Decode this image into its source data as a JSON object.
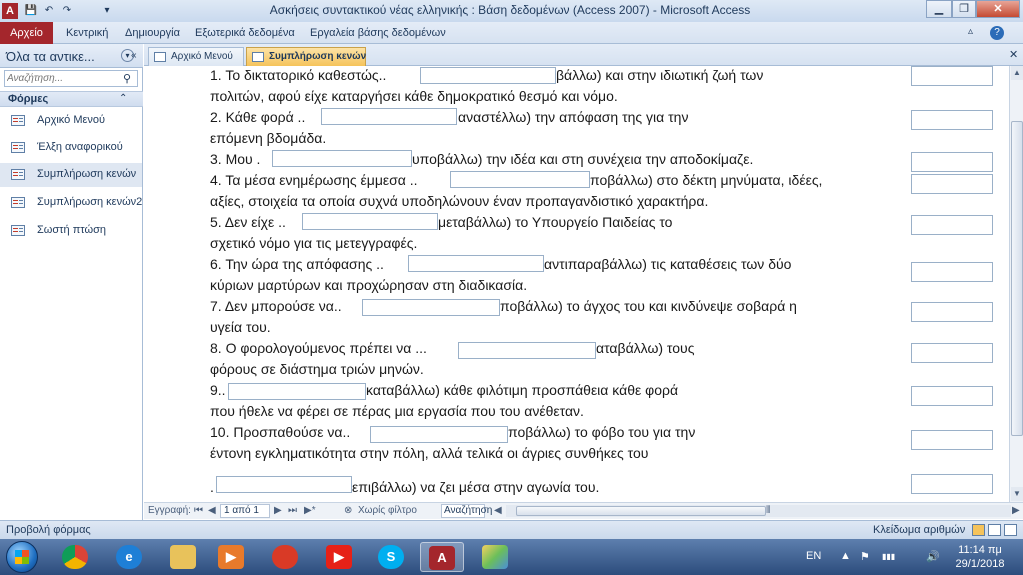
{
  "window": {
    "title": "Ασκήσεις συντακτικού νέας ελληνικής : Βάση δεδομένων (Access 2007)  -  Microsoft Access",
    "controls": {
      "minimize": "▁",
      "restore": "❐",
      "close": "✕"
    }
  },
  "quick_access": {
    "app_icon": "A",
    "save_icon": "💾",
    "undo_icon": "↶",
    "redo_icon": "↷",
    "customize_icon": "▾"
  },
  "ribbon": {
    "file_tab": "Αρχείο",
    "tabs": [
      "Κεντρική",
      "Δημιουργία",
      "Εξωτερικά δεδομένα",
      "Εργαλεία βάσης δεδομένων"
    ],
    "minimize_icon": "▵",
    "help_icon": "?"
  },
  "nav_pane": {
    "header": "Όλα τα αντικε...",
    "dropdown_icon": "▾",
    "collapse_icon": "«",
    "search_placeholder": "Αναζήτηση...",
    "search_icon": "⚲",
    "group_label": "Φόρμες",
    "group_chevron": "⌃",
    "items": [
      {
        "label": "Αρχικό Μενού",
        "selected": false
      },
      {
        "label": "Έλξη αναφορικού",
        "selected": false
      },
      {
        "label": "Συμπλήρωση κενών",
        "selected": true
      },
      {
        "label": "Συμπλήρωση κενών2",
        "selected": false
      },
      {
        "label": "Σωστή πτώση",
        "selected": false
      }
    ]
  },
  "doc_tabs": {
    "tabs": [
      {
        "label": "Αρχικό Μενού",
        "active": false
      },
      {
        "label": "Συμπλήρωση κενών",
        "active": true
      }
    ],
    "close_icon": "✕"
  },
  "form": {
    "lines": [
      {
        "a": "1.  Το δικτατορικό καθεστώς..",
        "b": "βάλλω) και στην ιδιωτική ζωή των"
      },
      {
        "a": "πολιτών, αφού είχε καταργήσει κάθε δημοκρατικό θεσμό και νόμο.",
        "b": ""
      },
      {
        "a": "2.  Κάθε φορά ..",
        "b": "αναστέλλω) την απόφαση της για την"
      },
      {
        "a": "επόμενη βδομάδα.",
        "b": ""
      },
      {
        "a": "3.  Μου .",
        "b": "υποβάλλω) την ιδέα και στη συνέχεια την αποδοκίμαζε."
      },
      {
        "a": "4.  Τα μέσα ενημέρωσης έμμεσα ..",
        "b": "ποβάλλω) στο δέκτη μηνύματα, ιδέες,"
      },
      {
        "a": "αξίες, στοιχεία τα οποία συχνά υποδηλώνουν έναν προπαγανδιστικό χαρακτήρα.",
        "b": ""
      },
      {
        "a": "5.  Δεν είχε ..",
        "b": "μεταβάλλω) το Υπουργείο Παιδείας το"
      },
      {
        "a": "σχετικό νόμο για τις μετεγγραφές.",
        "b": ""
      },
      {
        "a": "6.  Την ώρα της απόφασης ..",
        "b": "αντιπαραβάλλω) τις καταθέσεις των δύο"
      },
      {
        "a": "κύριων μαρτύρων και προχώρησαν στη διαδικασία.",
        "b": ""
      },
      {
        "a": "7.  Δεν μπορούσε να..",
        "b": "ποβάλλω) το άγχος του και κινδύνεψε σοβαρά η"
      },
      {
        "a": "υγεία του.",
        "b": ""
      },
      {
        "a": "8.  Ο φορολογούμενος πρέπει να ...",
        "b": "αταβάλλω) τους"
      },
      {
        "a": "φόρους σε διάστημα τριών μηνών.",
        "b": ""
      },
      {
        "a": "9..",
        "b": "καταβάλλω) κάθε φιλότιμη προσπάθεια κάθε φορά"
      },
      {
        "a": "που ήθελε να φέρει σε πέρας μια εργασία που του ανέθεταν.",
        "b": ""
      },
      {
        "a": "10. Προσπαθούσε να..",
        "b": "ποβάλλω) το φόβο του για την"
      },
      {
        "a": "έντονη εγκληματικότητα στην πόλη, αλλά τελικά οι άγριες συνθήκες του",
        "b": ""
      },
      {
        "a": ".",
        "b": "επιβάλλω) να ζει μέσα στην αγωνία του."
      }
    ]
  },
  "scroll": {
    "up": "▲",
    "down": "▼",
    "grip": "≡"
  },
  "record_nav": {
    "label": "Εγγραφή:",
    "first": "⏮",
    "prev": "◀",
    "position": "1 από 1",
    "next": "▶",
    "last": "⏭",
    "new": "▶*",
    "filter": "Χωρίς φίλτρο",
    "filter_icon": "⊗",
    "search": "Αναζήτηση",
    "hs_left": "◀",
    "hs_right": "▶",
    "hs_grip": "⦀"
  },
  "status": {
    "view": "Προβολή φόρμας",
    "numlock": "Κλείδωμα αριθμών"
  },
  "taskbar": {
    "lang": "EN",
    "time": "11:14 πμ",
    "date": "29/1/2018",
    "tray_icons": [
      "▲",
      "⚑",
      "▮▮▮",
      "🔊"
    ],
    "apps": [
      "chrome-icon",
      "ie-icon",
      "explorer-icon",
      "media-player-icon",
      "app-red-icon",
      "youtube-icon",
      "skype-icon",
      "access-icon",
      "paint-icon"
    ]
  },
  "colors": {
    "accent": "#a4262c",
    "ribbon": "#d6e2f1",
    "active_tab": "#f5c35b",
    "taskbar": "#2c4c7c"
  }
}
